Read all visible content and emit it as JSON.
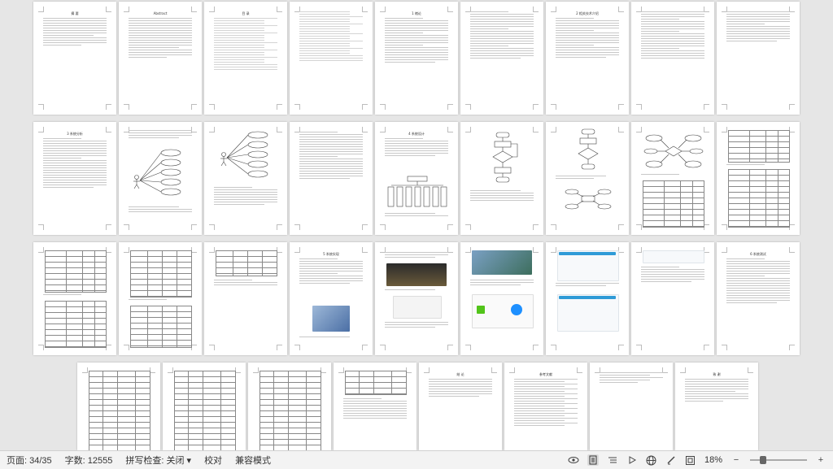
{
  "statusbar": {
    "page": "页面: 34/35",
    "word_count": "字数: 12555",
    "spell_check": "拼写检查: 关闭",
    "proofread": "校对",
    "compat_mode": "兼容模式",
    "zoom": "18%",
    "zoom_level": 0.18
  },
  "pages": {
    "p1_title": "摘  要",
    "p2_title": "Abstract",
    "p3_title": "目  录",
    "p5_title": "1 绪论",
    "p7_title": "2 相关技术介绍",
    "p10_title": "3 系统分析",
    "p14_title": "4 系统设计",
    "p22_title": "5 系统实现",
    "p27_title": "6 系统测试",
    "p33_title": "结  论",
    "p34_title": "参考文献",
    "p35_title": "致  谢"
  }
}
